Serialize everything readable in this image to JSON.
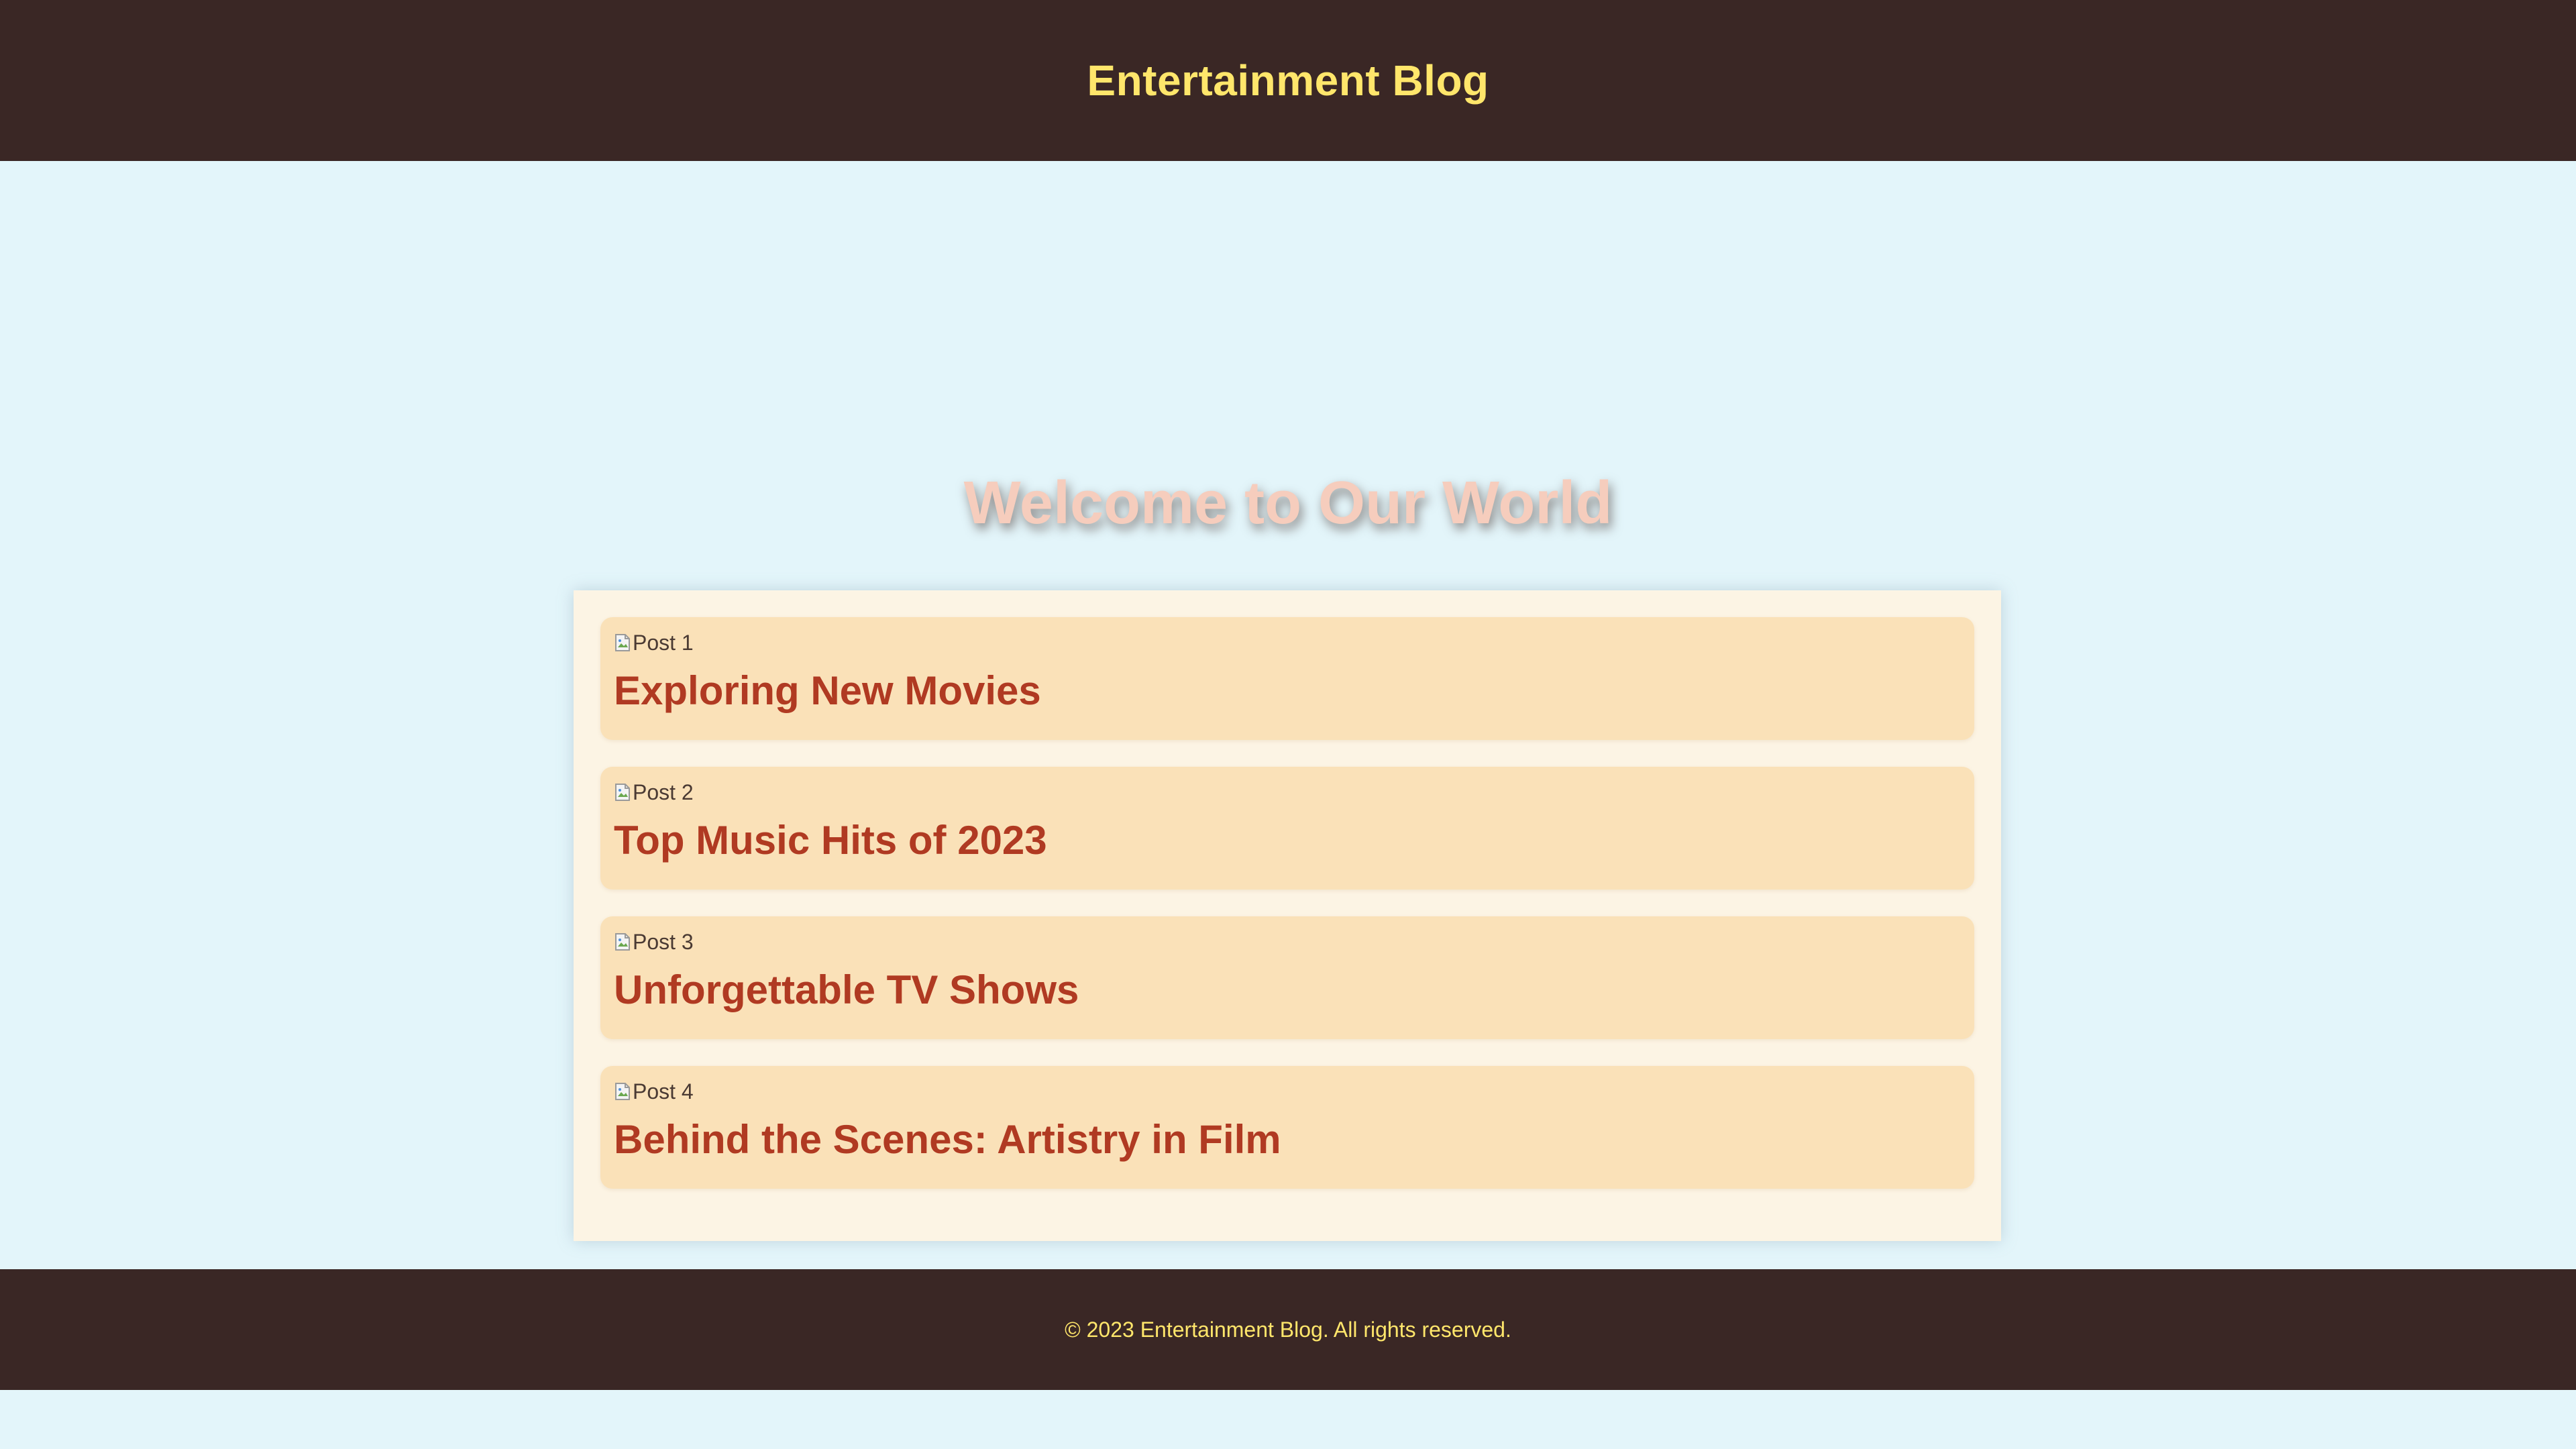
{
  "header": {
    "title": "Entertainment Blog"
  },
  "hero": {
    "heading": "Welcome to Our World"
  },
  "posts": [
    {
      "image_alt": "Post 1",
      "title": "Exploring New Movies"
    },
    {
      "image_alt": "Post 2",
      "title": "Top Music Hits of 2023"
    },
    {
      "image_alt": "Post 3",
      "title": "Unforgettable TV Shows"
    },
    {
      "image_alt": "Post 4",
      "title": "Behind the Scenes: Artistry in Film"
    }
  ],
  "footer": {
    "text": "© 2023 Entertainment Blog. All rights reserved."
  },
  "colors": {
    "header_bg": "#3a2725",
    "header_text": "#ffe66b",
    "page_bg": "#e3f5fa",
    "hero_text": "#f6cdbd",
    "panel_bg": "#fcf4e4",
    "card_bg": "#fae1b8",
    "post_title": "#b03a22"
  },
  "icons": {
    "post_image_placeholder": "broken-image-icon"
  }
}
